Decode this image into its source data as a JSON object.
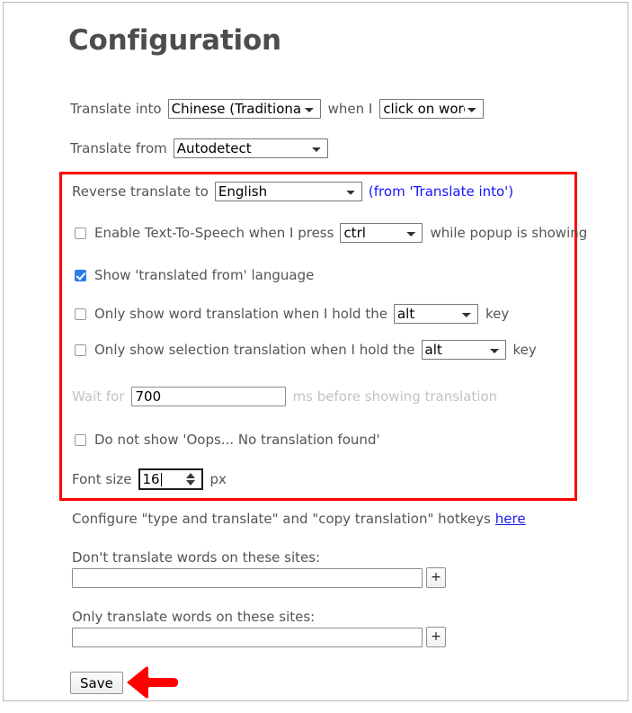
{
  "page": {
    "title": "Configuration"
  },
  "translate_into_row": {
    "label": "Translate into",
    "language_value": "Chinese (Traditional)",
    "mid_label": "when I",
    "trigger_value": "click on word"
  },
  "translate_from_row": {
    "label": "Translate from",
    "value": "Autodetect"
  },
  "reverse_row": {
    "label": "Reverse translate to",
    "value": "English",
    "note": "(from 'Translate into')"
  },
  "tts_row": {
    "label_before": "Enable Text-To-Speech when I press",
    "key_value": "ctrl",
    "label_after": "while popup is showing",
    "checked": false
  },
  "show_from_row": {
    "label": "Show 'translated from' language",
    "checked": true
  },
  "word_hold_row": {
    "label_before": "Only show word translation when I hold the",
    "key_value": "alt",
    "label_after": "key",
    "checked": false
  },
  "selection_hold_row": {
    "label_before": "Only show selection translation when I hold the",
    "key_value": "alt",
    "label_after": "key",
    "checked": false
  },
  "wait_row": {
    "label_before": "Wait for",
    "value": "700",
    "label_after": "ms before showing translation",
    "disabled": true
  },
  "oops_row": {
    "label": "Do not show 'Oops... No translation found'",
    "checked": false
  },
  "font_size_row": {
    "label_before": "Font size",
    "value": "16",
    "label_after": "px"
  },
  "hotkeys_row": {
    "text": "Configure \"type and translate\" and \"copy translation\" hotkeys",
    "link_label": "here"
  },
  "blocklist": {
    "label": "Don't translate words on these sites:",
    "value": "",
    "placeholder": "",
    "add_label": "+"
  },
  "allowlist": {
    "label": "Only translate words on these sites:",
    "value": "",
    "placeholder": "",
    "add_label": "+"
  },
  "footer": {
    "save_label": "Save"
  },
  "annotations": {
    "highlight_color": "#ff0000",
    "arrow_color": "#ff0000",
    "checkbox_accent": "#2b7de9",
    "note_color": "#1414ff"
  }
}
